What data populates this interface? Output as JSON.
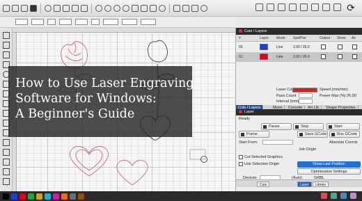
{
  "overlay": {
    "line1": "How to Use Laser Engraving",
    "line2": "Software for Windows:",
    "line3": "A Beginner's Guide"
  },
  "layers_panel": {
    "title": "Cuts / Layers",
    "columns": [
      "#",
      "Layer",
      "Mode",
      "Spd/Pwr",
      "Output",
      "Show",
      "Air"
    ],
    "rows": [
      {
        "num": "00",
        "mode": "Line",
        "speed_power": "2.00 / 26.0",
        "color": "#1f3ed6",
        "selected": false
      },
      {
        "num": "01",
        "mode": "Line",
        "speed_power": "2.00 / 26.0",
        "color": "#e0001d",
        "selected": true
      }
    ],
    "cut_color_label": "Laser Color",
    "cut_color": "#e61b1b",
    "speed_label": "Speed (mm/min)",
    "pass_label": "Pass Count",
    "pass_value": "1",
    "power_label": "Power Max (%)",
    "power_value": "26.00",
    "interval_label": "Interval (mm)"
  },
  "tabs": [
    "Cuts / Layers",
    "Move",
    "Console",
    "Art Lib",
    "Shape Properties"
  ],
  "laser_panel": {
    "title": "Laser",
    "status": "Ready",
    "pause_label": "Pause",
    "stop_label": "Stop",
    "start_label": "Start",
    "frame_label": "Frame",
    "send_gcode_label": "Save GCode",
    "run_gcode_label": "Run GCode",
    "start_from_label": "Start From:",
    "start_from_value": "Absolute Coords",
    "job_origin_label": "Job Origin",
    "cut_selected_label": "Cut Selected Graphics",
    "use_selection_label": "Use Selection Origin",
    "show_last_position_label": "Show Last Position",
    "optimization_label": "Optimization Settings",
    "devices_label": "Devices",
    "device_value": "(Auto)",
    "port_value": "GRBL"
  },
  "bottom_tabs": [
    "Cuts",
    "Laser",
    "Library"
  ],
  "palette_colors": [
    "#000000",
    "#1f3ed6",
    "#e0001d",
    "#1ca63b",
    "#d4a21a",
    "#1bb3c8",
    "#c61db8",
    "#e86d12",
    "#6e6e6e",
    "#8b4f1c"
  ]
}
